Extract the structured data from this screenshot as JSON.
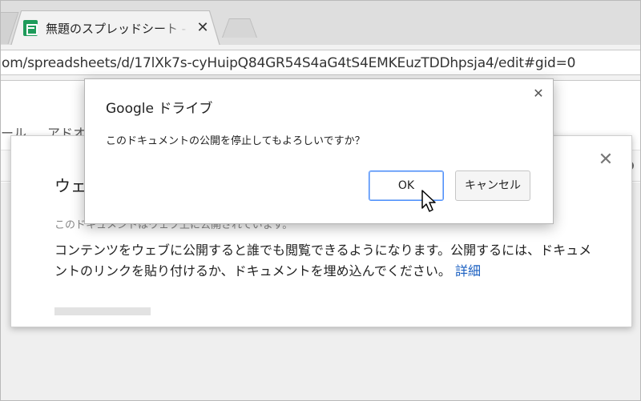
{
  "browser": {
    "tab_title": "無題のスプレッドシート - Google スプレッドシート",
    "tab_close": "✕",
    "url": "om/spreadsheets/d/17lXk7s-cyHuipQ84GR54S4aG4tS4EMKEuzTDDhpsja4/edit#gid=0"
  },
  "app": {
    "menu_tools": "ール",
    "menu_addons": "アドオ"
  },
  "publish_panel": {
    "close": "✕",
    "title": "ウェブに公開",
    "note": "このドキュメントはウェブ上に公開されています。",
    "description": "コンテンツをウェブに公開すると誰でも閲覧できるようになります。公開するには、ドキュメントのリンクを貼り付けるか、ドキュメントを埋め込んでください。",
    "learn_more": "詳細"
  },
  "dialog": {
    "title": "Google ドライブ",
    "close": "✕",
    "message": "このドキュメントの公開を停止してもよろしいですか？",
    "ok_label": "OK",
    "cancel_label": "キャンセル"
  }
}
